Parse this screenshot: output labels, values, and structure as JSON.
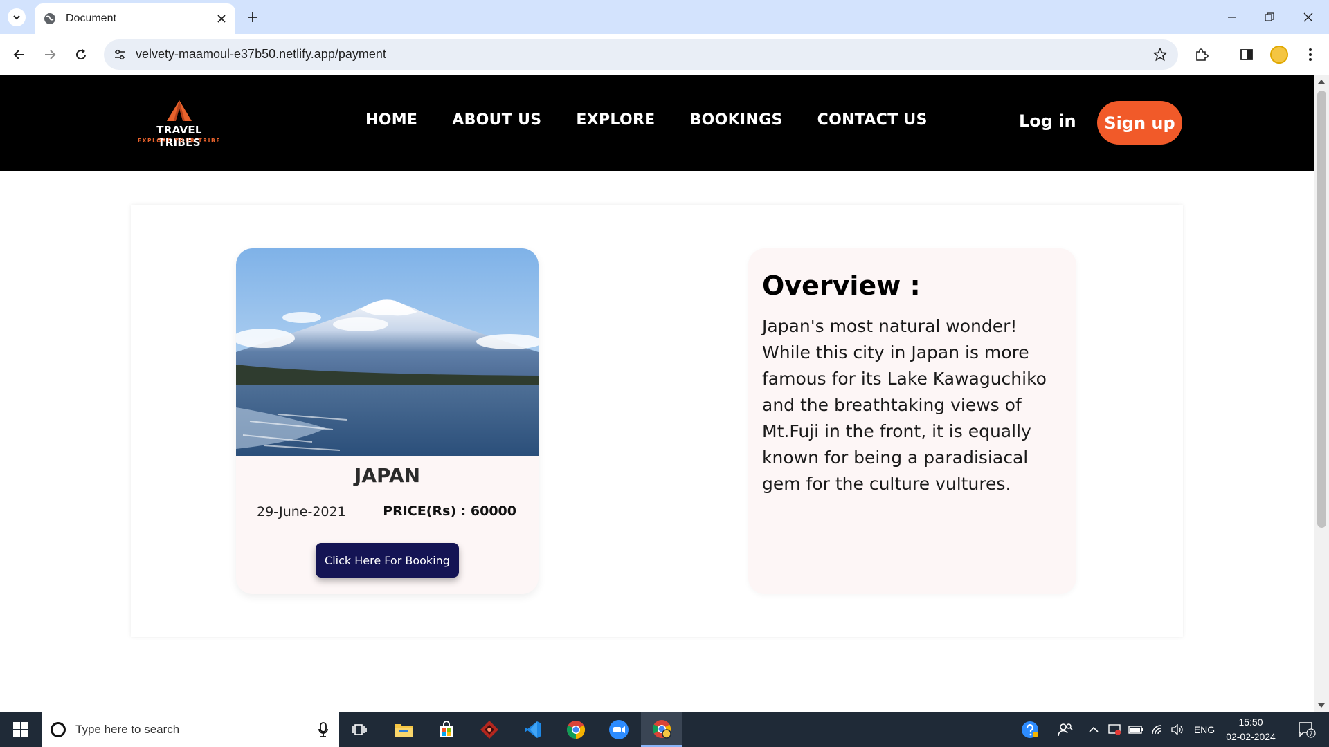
{
  "browser": {
    "tab_title": "Document",
    "url": "velvety-maamoul-e37b50.netlify.app/payment"
  },
  "site": {
    "logo_text": "TRAVEL TRIBES",
    "logo_tagline": "EXPLORE YOUR TRIBE",
    "nav_items": [
      "HOME",
      "ABOUT US",
      "EXPLORE",
      "BOOKINGS",
      "CONTACT US"
    ],
    "login_label": "Log in",
    "signup_label": "Sign up",
    "accent_color": "#f15a29"
  },
  "destination": {
    "name": "JAPAN",
    "date": "29-June-2021",
    "price": "PRICE(Rs) : 60000",
    "booking_button": "Click Here For Booking",
    "image": "mount-fuji-lake-photo"
  },
  "overview": {
    "title": "Overview :",
    "text": "Japan's most natural wonder! While this city in Japan is more famous for its Lake Kawaguchiko and the breathtaking views of Mt.Fuji in the front, it is equally known for being a paradisiacal gem for the culture vultures."
  },
  "taskbar": {
    "search_placeholder": "Type here to search",
    "language": "ENG",
    "time": "15:50",
    "date": "02-02-2024",
    "notification_count": "7"
  }
}
